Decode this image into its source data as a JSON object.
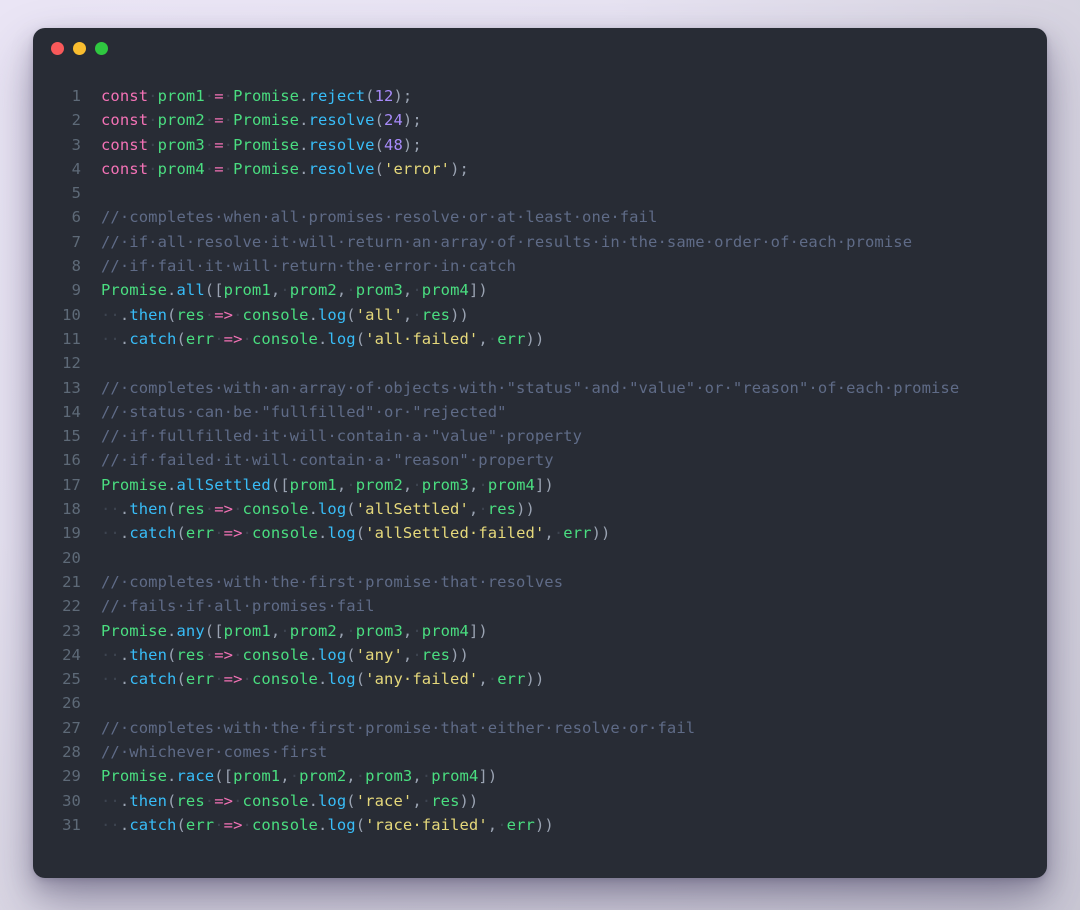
{
  "window": {
    "chrome": {
      "traffic_lights": [
        {
          "name": "close",
          "color": "#f8595a"
        },
        {
          "name": "minimize",
          "color": "#f9bd2f"
        },
        {
          "name": "maximize",
          "color": "#2fc840"
        }
      ]
    },
    "background_color": "#282c35",
    "page_background_color": "#e9e5f3"
  },
  "editor": {
    "language": "javascript",
    "first_line_number": 1,
    "total_lines": 31,
    "lines": [
      {
        "n": "1",
        "text": "const prom1 = Promise.reject(12);"
      },
      {
        "n": "2",
        "text": "const prom2 = Promise.resolve(24);"
      },
      {
        "n": "3",
        "text": "const prom3 = Promise.resolve(48);"
      },
      {
        "n": "4",
        "text": "const prom4 = Promise.resolve('error');"
      },
      {
        "n": "5",
        "text": ""
      },
      {
        "n": "6",
        "text": "// completes when all promises resolve or at least one fail"
      },
      {
        "n": "7",
        "text": "// if all resolve it will return an array of results in the same order of each promise"
      },
      {
        "n": "8",
        "text": "// if fail it will return the error in catch"
      },
      {
        "n": "9",
        "text": "Promise.all([prom1, prom2, prom3, prom4])"
      },
      {
        "n": "10",
        "text": "  .then(res => console.log('all', res))"
      },
      {
        "n": "11",
        "text": "  .catch(err => console.log('all failed', err))"
      },
      {
        "n": "12",
        "text": ""
      },
      {
        "n": "13",
        "text": "// completes with an array of objects with \"status\" and \"value\" or \"reason\" of each promise"
      },
      {
        "n": "14",
        "text": "// status can be \"fullfilled\" or \"rejected\""
      },
      {
        "n": "15",
        "text": "// if fullfilled it will contain a \"value\" property"
      },
      {
        "n": "16",
        "text": "// if failed it will contain a \"reason\" property"
      },
      {
        "n": "17",
        "text": "Promise.allSettled([prom1, prom2, prom3, prom4])"
      },
      {
        "n": "18",
        "text": "  .then(res => console.log('allSettled', res))"
      },
      {
        "n": "19",
        "text": "  .catch(err => console.log('allSettled failed', err))"
      },
      {
        "n": "20",
        "text": ""
      },
      {
        "n": "21",
        "text": "// completes with the first promise that resolves"
      },
      {
        "n": "22",
        "text": "// fails if all promises fail"
      },
      {
        "n": "23",
        "text": "Promise.any([prom1, prom2, prom3, prom4])"
      },
      {
        "n": "24",
        "text": "  .then(res => console.log('any', res))"
      },
      {
        "n": "25",
        "text": "  .catch(err => console.log('any failed', err))"
      },
      {
        "n": "26",
        "text": ""
      },
      {
        "n": "27",
        "text": "// completes with the first promise that either resolve or fail"
      },
      {
        "n": "28",
        "text": "// whichever comes first"
      },
      {
        "n": "29",
        "text": "Promise.race([prom1, prom2, prom3, prom4])"
      },
      {
        "n": "30",
        "text": "  .then(res => console.log('race', res))"
      },
      {
        "n": "31",
        "text": "  .catch(err => console.log('race failed', err))"
      }
    ],
    "tokens": [
      [
        [
          "t-kw",
          "const"
        ],
        [
          "sp",
          "·"
        ],
        [
          "t-var",
          "prom1"
        ],
        [
          "sp",
          "·"
        ],
        [
          "t-op",
          "="
        ],
        [
          "sp",
          "·"
        ],
        [
          "t-cls",
          "Promise"
        ],
        [
          "t-punc",
          "."
        ],
        [
          "t-fn",
          "reject"
        ],
        [
          "t-punc",
          "("
        ],
        [
          "t-num",
          "12"
        ],
        [
          "t-punc",
          ");"
        ]
      ],
      [
        [
          "t-kw",
          "const"
        ],
        [
          "sp",
          "·"
        ],
        [
          "t-var",
          "prom2"
        ],
        [
          "sp",
          "·"
        ],
        [
          "t-op",
          "="
        ],
        [
          "sp",
          "·"
        ],
        [
          "t-cls",
          "Promise"
        ],
        [
          "t-punc",
          "."
        ],
        [
          "t-fn",
          "resolve"
        ],
        [
          "t-punc",
          "("
        ],
        [
          "t-num",
          "24"
        ],
        [
          "t-punc",
          ");"
        ]
      ],
      [
        [
          "t-kw",
          "const"
        ],
        [
          "sp",
          "·"
        ],
        [
          "t-var",
          "prom3"
        ],
        [
          "sp",
          "·"
        ],
        [
          "t-op",
          "="
        ],
        [
          "sp",
          "·"
        ],
        [
          "t-cls",
          "Promise"
        ],
        [
          "t-punc",
          "."
        ],
        [
          "t-fn",
          "resolve"
        ],
        [
          "t-punc",
          "("
        ],
        [
          "t-num",
          "48"
        ],
        [
          "t-punc",
          ");"
        ]
      ],
      [
        [
          "t-kw",
          "const"
        ],
        [
          "sp",
          "·"
        ],
        [
          "t-var",
          "prom4"
        ],
        [
          "sp",
          "·"
        ],
        [
          "t-op",
          "="
        ],
        [
          "sp",
          "·"
        ],
        [
          "t-cls",
          "Promise"
        ],
        [
          "t-punc",
          "."
        ],
        [
          "t-fn",
          "resolve"
        ],
        [
          "t-punc",
          "("
        ],
        [
          "t-str",
          "'error'"
        ],
        [
          "t-punc",
          ");"
        ]
      ],
      [],
      [
        [
          "t-cmt",
          "//·completes·when·all·promises·resolve·or·at·least·one·fail"
        ]
      ],
      [
        [
          "t-cmt",
          "//·if·all·resolve·it·will·return·an·array·of·results·in·the·same·order·of·each·promise"
        ]
      ],
      [
        [
          "t-cmt",
          "//·if·fail·it·will·return·the·error·in·catch"
        ]
      ],
      [
        [
          "t-cls",
          "Promise"
        ],
        [
          "t-punc",
          "."
        ],
        [
          "t-fn",
          "all"
        ],
        [
          "t-punc",
          "(["
        ],
        [
          "t-var",
          "prom1"
        ],
        [
          "t-punc",
          ","
        ],
        [
          "sp",
          "·"
        ],
        [
          "t-var",
          "prom2"
        ],
        [
          "t-punc",
          ","
        ],
        [
          "sp",
          "·"
        ],
        [
          "t-var",
          "prom3"
        ],
        [
          "t-punc",
          ","
        ],
        [
          "sp",
          "·"
        ],
        [
          "t-var",
          "prom4"
        ],
        [
          "t-punc",
          "])"
        ]
      ],
      [
        [
          "t-dot",
          "··"
        ],
        [
          "t-punc",
          "."
        ],
        [
          "t-fn",
          "then"
        ],
        [
          "t-punc",
          "("
        ],
        [
          "t-var",
          "res"
        ],
        [
          "sp",
          "·"
        ],
        [
          "t-op",
          "=>"
        ],
        [
          "sp",
          "·"
        ],
        [
          "t-cls",
          "console"
        ],
        [
          "t-punc",
          "."
        ],
        [
          "t-fn",
          "log"
        ],
        [
          "t-punc",
          "("
        ],
        [
          "t-str",
          "'all'"
        ],
        [
          "t-punc",
          ","
        ],
        [
          "sp",
          "·"
        ],
        [
          "t-var",
          "res"
        ],
        [
          "t-punc",
          "))"
        ]
      ],
      [
        [
          "t-dot",
          "··"
        ],
        [
          "t-punc",
          "."
        ],
        [
          "t-fn",
          "catch"
        ],
        [
          "t-punc",
          "("
        ],
        [
          "t-var",
          "err"
        ],
        [
          "sp",
          "·"
        ],
        [
          "t-op",
          "=>"
        ],
        [
          "sp",
          "·"
        ],
        [
          "t-cls",
          "console"
        ],
        [
          "t-punc",
          "."
        ],
        [
          "t-fn",
          "log"
        ],
        [
          "t-punc",
          "("
        ],
        [
          "t-str",
          "'all·failed'"
        ],
        [
          "t-punc",
          ","
        ],
        [
          "sp",
          "·"
        ],
        [
          "t-var",
          "err"
        ],
        [
          "t-punc",
          "))"
        ]
      ],
      [],
      [
        [
          "t-cmt",
          "//·completes·with·an·array·of·objects·with·\"status\"·and·\"value\"·or·\"reason\"·of·each·promise"
        ]
      ],
      [
        [
          "t-cmt",
          "//·status·can·be·\"fullfilled\"·or·\"rejected\""
        ]
      ],
      [
        [
          "t-cmt",
          "//·if·fullfilled·it·will·contain·a·\"value\"·property"
        ]
      ],
      [
        [
          "t-cmt",
          "//·if·failed·it·will·contain·a·\"reason\"·property"
        ]
      ],
      [
        [
          "t-cls",
          "Promise"
        ],
        [
          "t-punc",
          "."
        ],
        [
          "t-fn",
          "allSettled"
        ],
        [
          "t-punc",
          "(["
        ],
        [
          "t-var",
          "prom1"
        ],
        [
          "t-punc",
          ","
        ],
        [
          "sp",
          "·"
        ],
        [
          "t-var",
          "prom2"
        ],
        [
          "t-punc",
          ","
        ],
        [
          "sp",
          "·"
        ],
        [
          "t-var",
          "prom3"
        ],
        [
          "t-punc",
          ","
        ],
        [
          "sp",
          "·"
        ],
        [
          "t-var",
          "prom4"
        ],
        [
          "t-punc",
          "])"
        ]
      ],
      [
        [
          "t-dot",
          "··"
        ],
        [
          "t-punc",
          "."
        ],
        [
          "t-fn",
          "then"
        ],
        [
          "t-punc",
          "("
        ],
        [
          "t-var",
          "res"
        ],
        [
          "sp",
          "·"
        ],
        [
          "t-op",
          "=>"
        ],
        [
          "sp",
          "·"
        ],
        [
          "t-cls",
          "console"
        ],
        [
          "t-punc",
          "."
        ],
        [
          "t-fn",
          "log"
        ],
        [
          "t-punc",
          "("
        ],
        [
          "t-str",
          "'allSettled'"
        ],
        [
          "t-punc",
          ","
        ],
        [
          "sp",
          "·"
        ],
        [
          "t-var",
          "res"
        ],
        [
          "t-punc",
          "))"
        ]
      ],
      [
        [
          "t-dot",
          "··"
        ],
        [
          "t-punc",
          "."
        ],
        [
          "t-fn",
          "catch"
        ],
        [
          "t-punc",
          "("
        ],
        [
          "t-var",
          "err"
        ],
        [
          "sp",
          "·"
        ],
        [
          "t-op",
          "=>"
        ],
        [
          "sp",
          "·"
        ],
        [
          "t-cls",
          "console"
        ],
        [
          "t-punc",
          "."
        ],
        [
          "t-fn",
          "log"
        ],
        [
          "t-punc",
          "("
        ],
        [
          "t-str",
          "'allSettled·failed'"
        ],
        [
          "t-punc",
          ","
        ],
        [
          "sp",
          "·"
        ],
        [
          "t-var",
          "err"
        ],
        [
          "t-punc",
          "))"
        ]
      ],
      [],
      [
        [
          "t-cmt",
          "//·completes·with·the·first·promise·that·resolves"
        ]
      ],
      [
        [
          "t-cmt",
          "//·fails·if·all·promises·fail"
        ]
      ],
      [
        [
          "t-cls",
          "Promise"
        ],
        [
          "t-punc",
          "."
        ],
        [
          "t-fn",
          "any"
        ],
        [
          "t-punc",
          "(["
        ],
        [
          "t-var",
          "prom1"
        ],
        [
          "t-punc",
          ","
        ],
        [
          "sp",
          "·"
        ],
        [
          "t-var",
          "prom2"
        ],
        [
          "t-punc",
          ","
        ],
        [
          "sp",
          "·"
        ],
        [
          "t-var",
          "prom3"
        ],
        [
          "t-punc",
          ","
        ],
        [
          "sp",
          "·"
        ],
        [
          "t-var",
          "prom4"
        ],
        [
          "t-punc",
          "])"
        ]
      ],
      [
        [
          "t-dot",
          "··"
        ],
        [
          "t-punc",
          "."
        ],
        [
          "t-fn",
          "then"
        ],
        [
          "t-punc",
          "("
        ],
        [
          "t-var",
          "res"
        ],
        [
          "sp",
          "·"
        ],
        [
          "t-op",
          "=>"
        ],
        [
          "sp",
          "·"
        ],
        [
          "t-cls",
          "console"
        ],
        [
          "t-punc",
          "."
        ],
        [
          "t-fn",
          "log"
        ],
        [
          "t-punc",
          "("
        ],
        [
          "t-str",
          "'any'"
        ],
        [
          "t-punc",
          ","
        ],
        [
          "sp",
          "·"
        ],
        [
          "t-var",
          "res"
        ],
        [
          "t-punc",
          "))"
        ]
      ],
      [
        [
          "t-dot",
          "··"
        ],
        [
          "t-punc",
          "."
        ],
        [
          "t-fn",
          "catch"
        ],
        [
          "t-punc",
          "("
        ],
        [
          "t-var",
          "err"
        ],
        [
          "sp",
          "·"
        ],
        [
          "t-op",
          "=>"
        ],
        [
          "sp",
          "·"
        ],
        [
          "t-cls",
          "console"
        ],
        [
          "t-punc",
          "."
        ],
        [
          "t-fn",
          "log"
        ],
        [
          "t-punc",
          "("
        ],
        [
          "t-str",
          "'any·failed'"
        ],
        [
          "t-punc",
          ","
        ],
        [
          "sp",
          "·"
        ],
        [
          "t-var",
          "err"
        ],
        [
          "t-punc",
          "))"
        ]
      ],
      [],
      [
        [
          "t-cmt",
          "//·completes·with·the·first·promise·that·either·resolve·or·fail"
        ]
      ],
      [
        [
          "t-cmt",
          "//·whichever·comes·first"
        ]
      ],
      [
        [
          "t-cls",
          "Promise"
        ],
        [
          "t-punc",
          "."
        ],
        [
          "t-fn",
          "race"
        ],
        [
          "t-punc",
          "(["
        ],
        [
          "t-var",
          "prom1"
        ],
        [
          "t-punc",
          ","
        ],
        [
          "sp",
          "·"
        ],
        [
          "t-var",
          "prom2"
        ],
        [
          "t-punc",
          ","
        ],
        [
          "sp",
          "·"
        ],
        [
          "t-var",
          "prom3"
        ],
        [
          "t-punc",
          ","
        ],
        [
          "sp",
          "·"
        ],
        [
          "t-var",
          "prom4"
        ],
        [
          "t-punc",
          "])"
        ]
      ],
      [
        [
          "t-dot",
          "··"
        ],
        [
          "t-punc",
          "."
        ],
        [
          "t-fn",
          "then"
        ],
        [
          "t-punc",
          "("
        ],
        [
          "t-var",
          "res"
        ],
        [
          "sp",
          "·"
        ],
        [
          "t-op",
          "=>"
        ],
        [
          "sp",
          "·"
        ],
        [
          "t-cls",
          "console"
        ],
        [
          "t-punc",
          "."
        ],
        [
          "t-fn",
          "log"
        ],
        [
          "t-punc",
          "("
        ],
        [
          "t-str",
          "'race'"
        ],
        [
          "t-punc",
          ","
        ],
        [
          "sp",
          "·"
        ],
        [
          "t-var",
          "res"
        ],
        [
          "t-punc",
          "))"
        ]
      ],
      [
        [
          "t-dot",
          "··"
        ],
        [
          "t-punc",
          "."
        ],
        [
          "t-fn",
          "catch"
        ],
        [
          "t-punc",
          "("
        ],
        [
          "t-var",
          "err"
        ],
        [
          "sp",
          "·"
        ],
        [
          "t-op",
          "=>"
        ],
        [
          "sp",
          "·"
        ],
        [
          "t-cls",
          "console"
        ],
        [
          "t-punc",
          "."
        ],
        [
          "t-fn",
          "log"
        ],
        [
          "t-punc",
          "("
        ],
        [
          "t-str",
          "'race·failed'"
        ],
        [
          "t-punc",
          ","
        ],
        [
          "sp",
          "·"
        ],
        [
          "t-var",
          "err"
        ],
        [
          "t-punc",
          "))"
        ]
      ]
    ],
    "theme": {
      "keyword": "#f472b6",
      "operator": "#f472b6",
      "variable": "#4ade80",
      "class": "#4ade80",
      "function": "#38bdf8",
      "number": "#a78bfa",
      "string": "#e5d87b",
      "punctuation": "#9aa3b2",
      "comment": "#5f6b87",
      "line_number": "#5e6a78"
    }
  }
}
